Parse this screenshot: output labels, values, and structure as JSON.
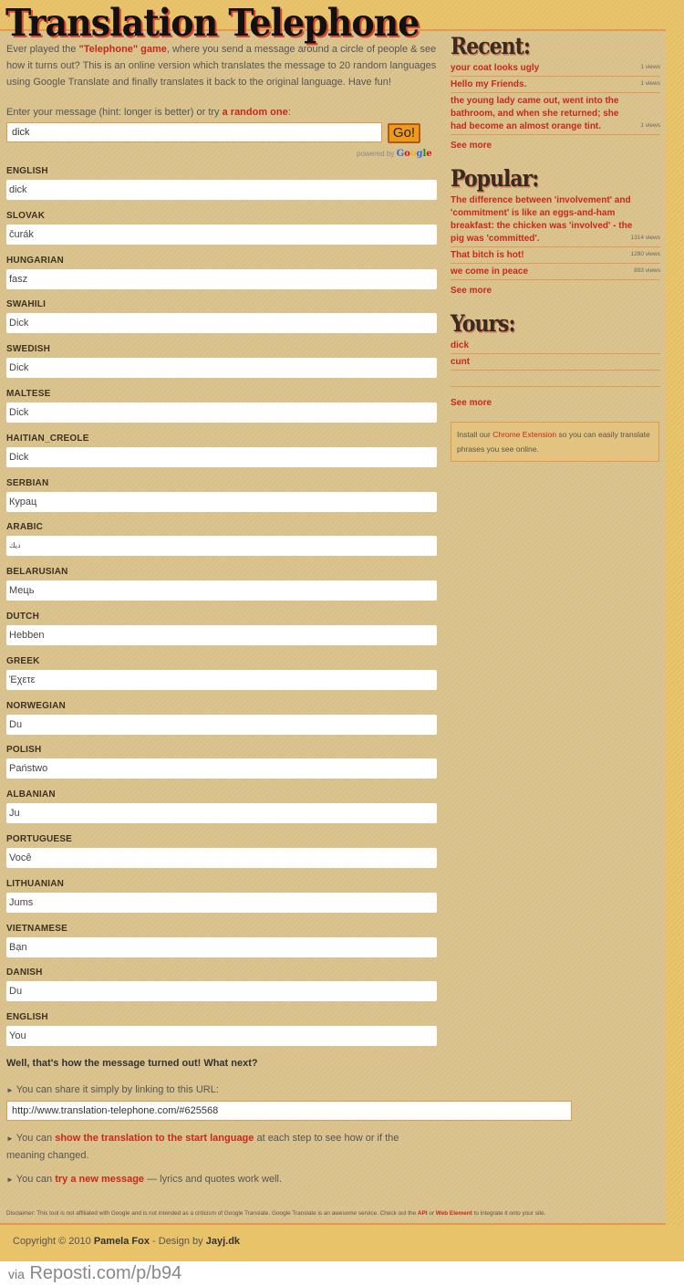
{
  "header": {
    "title": "Translation Telephone"
  },
  "intro": {
    "part1": "Ever played the ",
    "telephone_link": "\"Telephone\" game",
    "part2": ", where you send a message around a circle of people & see how it turns out? This is an online version which translates the message to 20 random languages using Google Translate and finally translates it back to the original language. Have fun!"
  },
  "form": {
    "prompt_text": "Enter your message (hint: longer is better) or try ",
    "random_link": "a random one",
    "prompt_suffix": ":",
    "message_value": "dick",
    "go_label": "Go!",
    "powered_by": "powered by"
  },
  "translations": [
    {
      "language": "ENGLISH",
      "text": "dick"
    },
    {
      "language": "SLOVAK",
      "text": "čurák"
    },
    {
      "language": "HUNGARIAN",
      "text": "fasz"
    },
    {
      "language": "SWAHILI",
      "text": "Dick"
    },
    {
      "language": "SWEDISH",
      "text": "Dick"
    },
    {
      "language": "MALTESE",
      "text": "Dick"
    },
    {
      "language": "HAITIAN_CREOLE",
      "text": "Dick"
    },
    {
      "language": "SERBIAN",
      "text": "Курац"
    },
    {
      "language": "ARABIC",
      "text": "ديك"
    },
    {
      "language": "BELARUSIAN",
      "text": "Мець"
    },
    {
      "language": "DUTCH",
      "text": "Hebben"
    },
    {
      "language": "GREEK",
      "text": "Έχετε"
    },
    {
      "language": "NORWEGIAN",
      "text": "Du"
    },
    {
      "language": "POLISH",
      "text": "Państwo"
    },
    {
      "language": "ALBANIAN",
      "text": "Ju"
    },
    {
      "language": "PORTUGUESE",
      "text": "Você"
    },
    {
      "language": "LITHUANIAN",
      "text": "Jums"
    },
    {
      "language": "VIETNAMESE",
      "text": "Bạn"
    },
    {
      "language": "DANISH",
      "text": "Du"
    },
    {
      "language": "ENGLISH",
      "text": "You"
    }
  ],
  "outcome": {
    "heading": "Well, that's how the message turned out! What next?",
    "share_text": "You can share it simply by linking to this URL:",
    "share_url": "http://www.translation-telephone.com/#625568",
    "show_prefix": "You can ",
    "show_link": "show the translation to the start language",
    "show_suffix": " at each step to see how or if the meaning changed.",
    "try_prefix": "You can ",
    "try_link": "try a new message",
    "try_suffix": " — lyrics and quotes work well."
  },
  "disclaimer": {
    "text": "Disclaimer: This tool is not affiliated with Google and is not intended as a criticism of Google Translate. Google Translate is an awesome service. Check out the ",
    "api_link": "API",
    "or": " or ",
    "web_element_link": "Web Element",
    "suffix": " to integrate it onto your site."
  },
  "footer": {
    "copyright": "Copyright © 2010 ",
    "author": "Pamela Fox",
    "design_by": " - Design by ",
    "designer": "Jayj.dk"
  },
  "watermark": {
    "via": "via",
    "site": "Reposti.com/p/b94"
  },
  "sidebar": {
    "recent": {
      "title": "Recent:",
      "items": [
        {
          "text": "your coat looks ugly",
          "views": "1 views"
        },
        {
          "text": "Hello my Friends.",
          "views": "1 views"
        },
        {
          "text": "the young lady came out, went into the bathroom, and when she returned; she had become an almost orange tint.",
          "views": "1 views"
        }
      ],
      "see_more": "See more"
    },
    "popular": {
      "title": "Popular:",
      "items": [
        {
          "text": "The difference between 'involvement' and 'commitment' is like an eggs-and-ham breakfast: the chicken was 'involved' - the pig was 'committed'.",
          "views": "1314 views"
        },
        {
          "text": "That bitch is hot!",
          "views": "1280 views"
        },
        {
          "text": "we come in peace",
          "views": "893 views"
        }
      ],
      "see_more": "See more"
    },
    "yours": {
      "title": "Yours:",
      "items": [
        {
          "text": "dick"
        },
        {
          "text": "cunt"
        }
      ],
      "see_more": "See more"
    },
    "chrome_box": {
      "prefix": "Install our ",
      "link": "Chrome Extension",
      "suffix": " so you can easily translate phrases you see online."
    }
  },
  "colors": {
    "link_red": "#c8281e",
    "accent_orange": "#e39a4f",
    "go_button": "#f09a1a",
    "page_bg": "#dbc490",
    "band_yellow": "#e8c36a"
  }
}
